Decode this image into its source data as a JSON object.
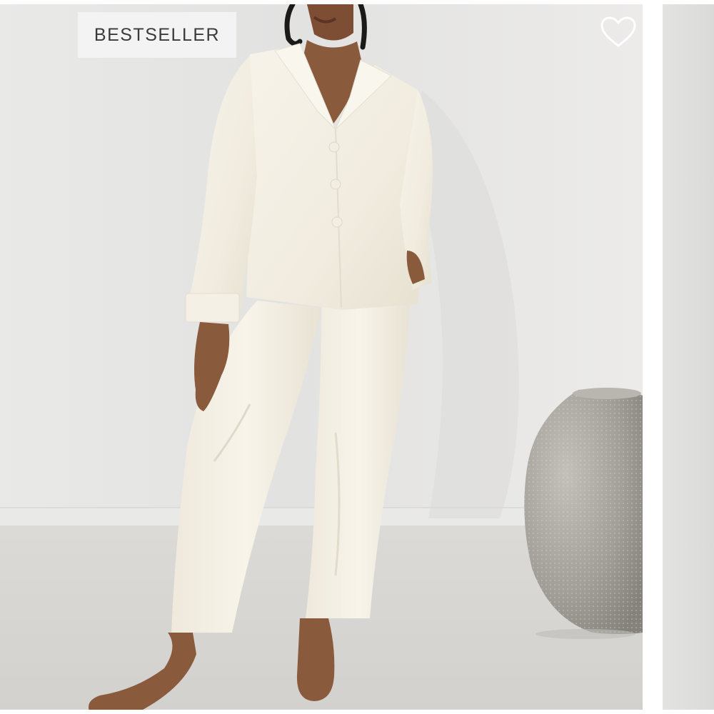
{
  "product_card": {
    "badge_text": "BESTSELLER",
    "wishlist_icon": "heart-outline-icon",
    "image_subject": "model-in-ivory-satin-pajama-set"
  },
  "colors": {
    "badge_bg": "#f3f3f3",
    "badge_text": "#3a3a3a",
    "wall": "#e4e4e3",
    "floor": "#d7d6d3",
    "garment": "#f4efe4",
    "skin": "#8a5a3c",
    "vase": "#a5a29c"
  }
}
